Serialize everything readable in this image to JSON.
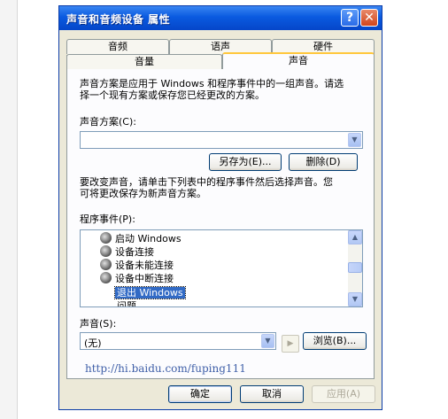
{
  "window": {
    "title": "声音和音频设备 属性",
    "help_glyph": "?",
    "close_glyph": "✕"
  },
  "tabs": {
    "row_back": [
      "音频",
      "语声",
      "硬件"
    ],
    "row_front": [
      "音量",
      "声音"
    ],
    "active": "声音"
  },
  "intro_text": [
    "声音方案是应用于 Windows 和程序事件中的一组声音。请选",
    "择一个现有方案或保存您已经更改的方案。"
  ],
  "scheme": {
    "label": "声音方案(C):",
    "value": "",
    "save_as_label": "另存为(E)...",
    "delete_label": "删除(D)"
  },
  "change_text": [
    "要改变声音，请单击下列表中的程序事件然后选择声音。您",
    "可将更改保存为新声音方案。"
  ],
  "events": {
    "label": "程序事件(P):",
    "items": [
      "启动 Windows",
      "设备连接",
      "设备未能连接",
      "设备中断连接",
      "退出 Windows",
      "问题"
    ],
    "selected": "退出 Windows"
  },
  "sound": {
    "label": "声音(S):",
    "value": "(无)",
    "browse_label": "浏览(B)..."
  },
  "watermark": "http://hi.baidu.com/fuping111",
  "footer": {
    "ok_label": "确定",
    "cancel_label": "取消",
    "apply_label": "应用(A)"
  },
  "colors": {
    "titlebar": "#0a5ae0",
    "selection": "#316ac5",
    "link": "#3f5fa8",
    "active_tab_accent": "#ffc73c"
  }
}
